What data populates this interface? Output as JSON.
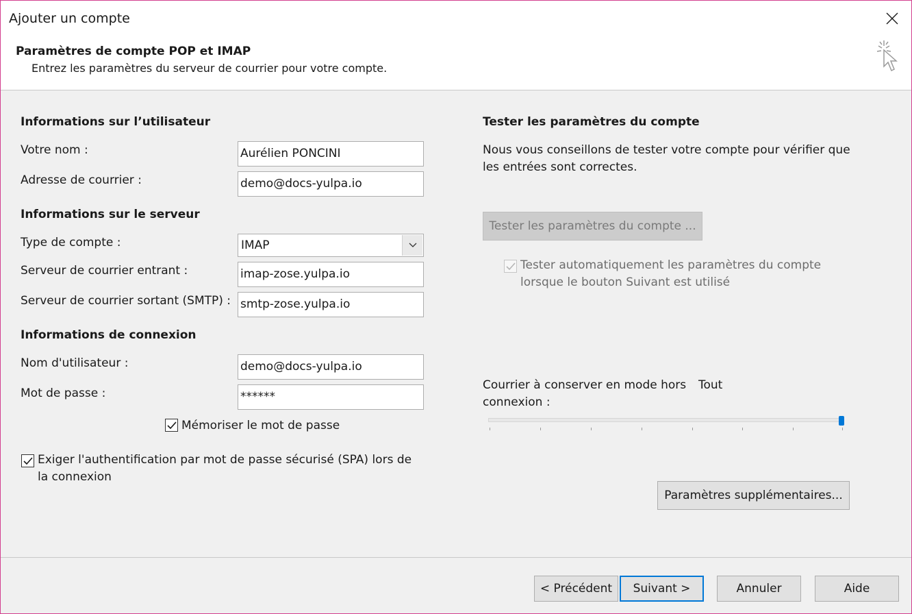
{
  "window": {
    "title": "Ajouter un compte"
  },
  "header": {
    "title": "Paramètres de compte POP et IMAP",
    "subtitle": "Entrez les paramètres du serveur de courrier pour votre compte."
  },
  "user_info": {
    "section_title": "Informations sur l’utilisateur",
    "name_label": "Votre nom :",
    "name_value": "Aurélien PONCINI",
    "email_label": "Adresse de courrier :",
    "email_value": "demo@docs-yulpa.io"
  },
  "server_info": {
    "section_title": "Informations sur le serveur",
    "account_type_label": "Type de compte :",
    "account_type_value": "IMAP",
    "incoming_label": "Serveur de courrier entrant :",
    "incoming_value": "imap-zose.yulpa.io",
    "outgoing_label": "Serveur de courrier sortant (SMTP) :",
    "outgoing_value": "smtp-zose.yulpa.io"
  },
  "login_info": {
    "section_title": "Informations de connexion",
    "username_label": "Nom d'utilisateur :",
    "username_value": "demo@docs-yulpa.io",
    "password_label": "Mot de passe :",
    "password_value": "******",
    "remember_label": "Mémoriser le mot de passe",
    "remember_checked": true,
    "spa_label_line1": "Exiger l'authentification par mot de passe sécurisé (SPA) lors de",
    "spa_label_line2": "la connexion",
    "spa_checked": true
  },
  "test_settings": {
    "section_title": "Tester les paramètres du compte",
    "description_line1": "Nous vous conseillons de tester votre compte pour vérifier que",
    "description_line2": "les entrées sont correctes.",
    "test_button": "Tester les paramètres du compte ...",
    "auto_test_line1": "Tester automatiquement les paramètres du compte",
    "auto_test_line2": "lorsque le bouton Suivant est utilisé",
    "auto_test_checked": true
  },
  "offline": {
    "label_line1": "Courrier à conserver en mode hors",
    "label_line2": "connexion :",
    "value_label": "Tout",
    "slider_fraction": 1.0
  },
  "more_settings_button": "Paramètres supplémentaires...",
  "footer": {
    "previous": "< Précédent",
    "next": "Suivant >",
    "cancel": "Annuler",
    "help": "Aide"
  },
  "colors": {
    "accent": "#0078d7",
    "window_border": "#d23f8f"
  }
}
